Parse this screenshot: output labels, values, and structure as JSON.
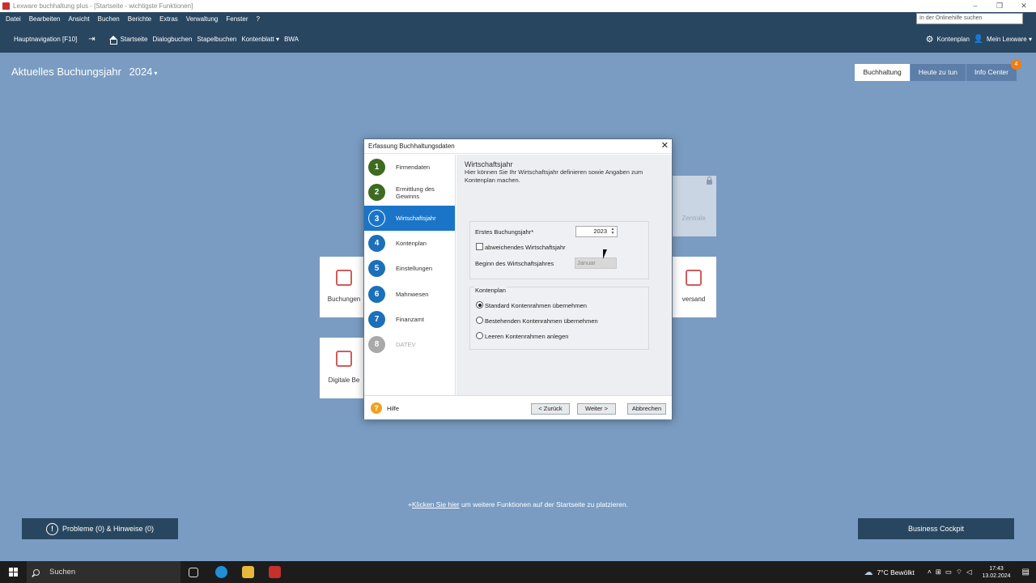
{
  "window": {
    "title": "Lexware buchhaltung plus - [Startseite - wichtigste Funktionen]",
    "controls": [
      "–",
      "❐",
      "✕"
    ]
  },
  "menu": {
    "items": [
      "Datei",
      "Bearbeiten",
      "Ansicht",
      "Buchen",
      "Berichte",
      "Extras",
      "Verwaltung",
      "Fenster",
      "?"
    ],
    "help_search_placeholder": "In der Onlinehilfe suchen"
  },
  "nav": {
    "hauptnavigation": "Hauptnavigation [F10]",
    "pin": "⇥",
    "items": [
      "Startseite",
      "Dialogbuchen",
      "Stapelbuchen",
      "Kontenblatt ▾",
      "BWA"
    ],
    "kontenplan": "Kontenplan",
    "mein_lexware": "Mein Lexware ▾"
  },
  "page": {
    "year_label": "Aktuelles Buchungsjahr",
    "year_value": "2024",
    "tabs": [
      "Buchhaltung",
      "Heute zu tun",
      "Info Center"
    ],
    "info_badge": "4",
    "tiles": {
      "buchungen": "Buchungen",
      "zentrale": "Zentrale",
      "versand": "versand",
      "digitale": "Digitale Be"
    },
    "hint_link": "Klicken Sie hier",
    "hint_rest": " um weitere Funktionen auf der Startseite zu platzieren.",
    "probleme": "Probleme (0) & Hinweise (0)",
    "cockpit": "Business Cockpit"
  },
  "dialog": {
    "title": "Erfassung Buchhaltungsdaten",
    "steps": [
      {
        "num": "1",
        "label": "Firmendaten",
        "state": "done"
      },
      {
        "num": "2",
        "label": "Ermittlung des Gewinns",
        "state": "done"
      },
      {
        "num": "3",
        "label": "Wirtschaftsjahr",
        "state": "active"
      },
      {
        "num": "4",
        "label": "Kontenplan",
        "state": "todo"
      },
      {
        "num": "5",
        "label": "Einstellungen",
        "state": "todo"
      },
      {
        "num": "6",
        "label": "Mahnwesen",
        "state": "todo"
      },
      {
        "num": "7",
        "label": "Finanzamt",
        "state": "todo"
      },
      {
        "num": "8",
        "label": "DATEV",
        "state": "off"
      }
    ],
    "section_title": "Wirtschaftsjahr",
    "section_desc": "Hier können Sie Ihr Wirtschaftsjahr definieren sowie Angaben zum Kontenplan machen.",
    "erstes_label": "Erstes Buchungsjahr*",
    "erstes_value": "2023",
    "abweichend_label": "abweichendes Wirtschaftsjahr",
    "beginn_label": "Beginn des Wirtschaftsjahres",
    "beginn_value": "Januar",
    "kontenplan_group": "Kontenplan",
    "radios": [
      "Standard Kontenrahmen übernehmen",
      "Bestehenden Kontenrahmen übernehmen",
      "Leeren Kontenrahmen anlegen"
    ],
    "hilfe": "Hilfe",
    "back": "< Zurück",
    "next": "Weiter >",
    "cancel": "Abbrechen"
  },
  "taskbar": {
    "search": "Suchen",
    "weather": "7°C  Bewölkt",
    "time": "17:43",
    "date": "13.02.2024"
  },
  "colors": {
    "nav": "#284660",
    "background": "#7a9cc2",
    "active_step": "#1a75c9",
    "done_step": "#3d6b1f",
    "badge": "#f07d13"
  }
}
